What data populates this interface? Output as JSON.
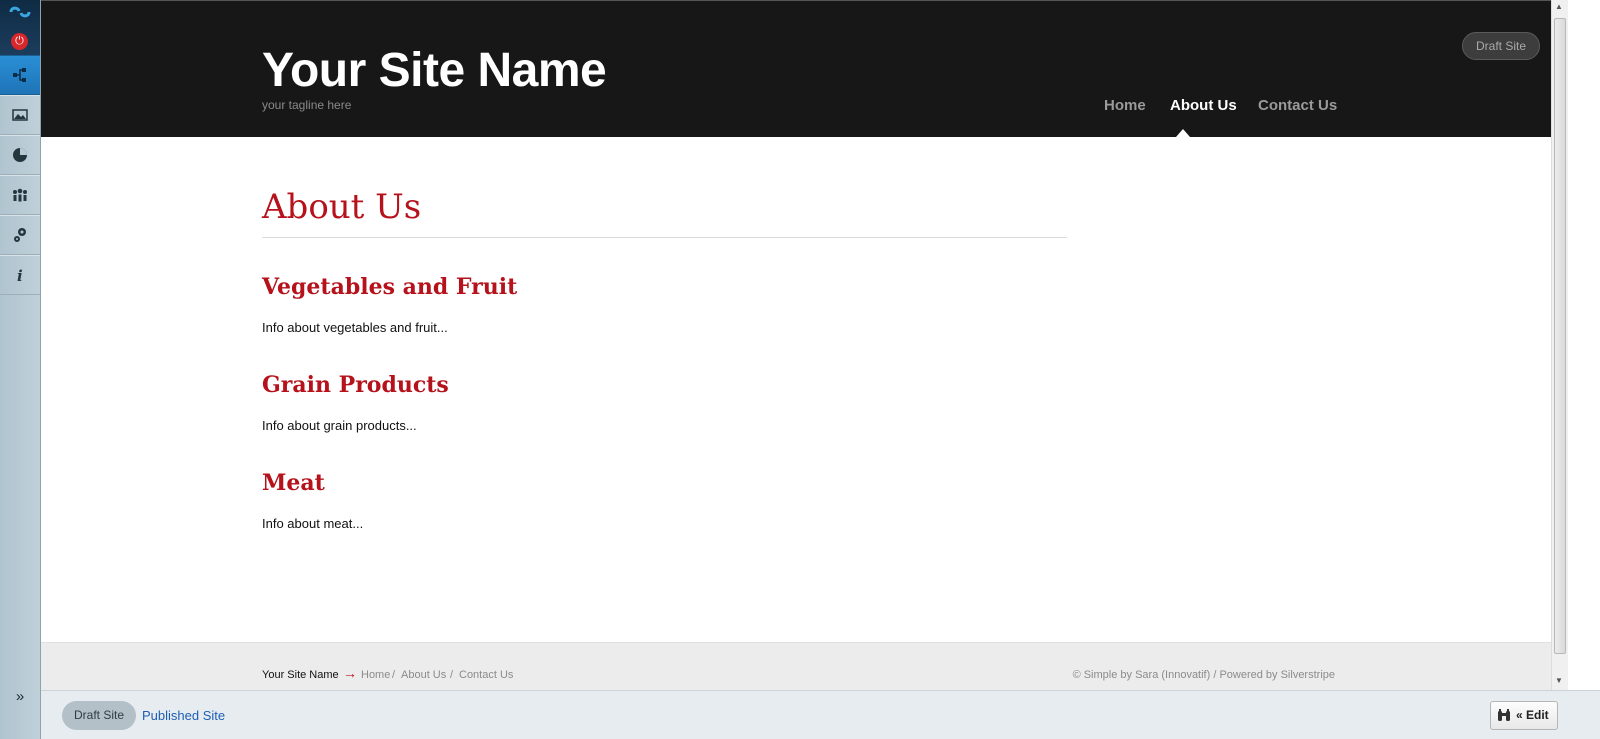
{
  "site": {
    "name": "Your Site Name",
    "tagline": "your tagline here",
    "draft_badge": "Draft Site"
  },
  "nav": [
    {
      "label": "Home",
      "active": false
    },
    {
      "label": "About Us",
      "active": true
    },
    {
      "label": "Contact Us",
      "active": false
    }
  ],
  "page": {
    "title": "About Us",
    "sections": [
      {
        "heading": "Vegetables and Fruit",
        "text": "Info about vegetables and fruit..."
      },
      {
        "heading": "Grain Products",
        "text": "Info about grain products..."
      },
      {
        "heading": "Meat",
        "text": "Info about meat..."
      }
    ]
  },
  "footer": {
    "site_name": "Your Site Name",
    "arrow": "→",
    "breadcrumbs": [
      "Home",
      "About Us",
      "Contact Us"
    ],
    "separator": "/",
    "credit": "© Simple by Sara (Innovatif) / Powered by Silverstripe"
  },
  "cms": {
    "sidebar_icons": [
      "logo-icon",
      "power-icon",
      "sitetree-icon",
      "image-icon",
      "reports-icon",
      "users-icon",
      "settings-icon",
      "help-icon"
    ],
    "expand": "»",
    "draft_label": "Draft Site",
    "published_label": "Published Site",
    "edit_label": "« Edit"
  }
}
